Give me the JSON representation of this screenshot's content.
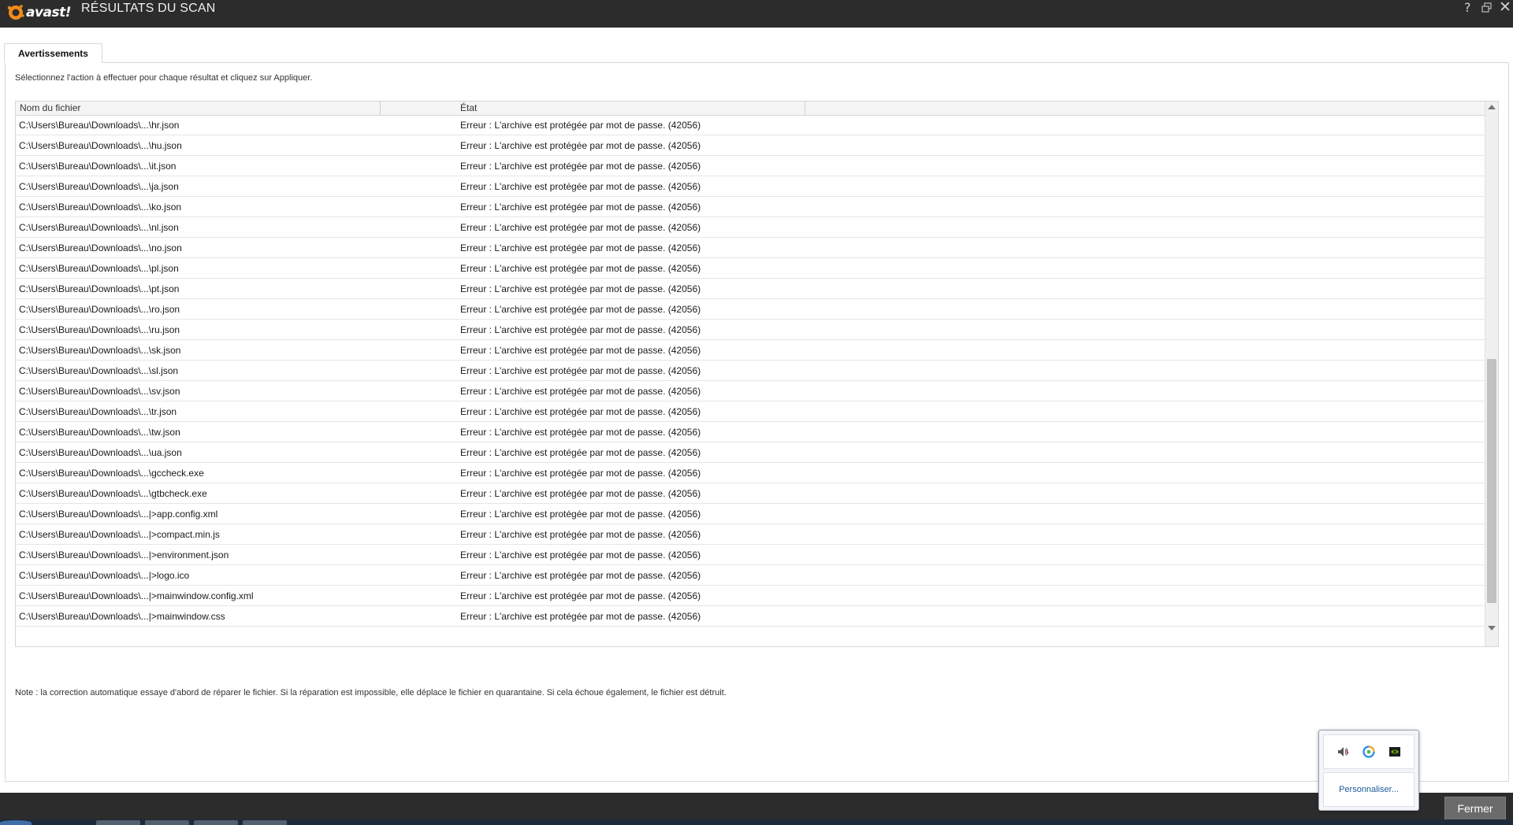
{
  "app": {
    "logo_text": "avast!",
    "title": "RÉSULTATS DU SCAN",
    "help_icon": "?",
    "restore_icon": "restore-icon",
    "close_icon": "✕"
  },
  "tabs": [
    {
      "label": "Avertissements"
    }
  ],
  "instruction": "Sélectionnez l'action à effectuer pour chaque résultat et cliquez sur Appliquer.",
  "table": {
    "columns": [
      "Nom du fichier",
      "État"
    ],
    "rows": [
      {
        "file": "C:\\Users\\Bureau\\Downloads\\...\\hr.json",
        "state": "Erreur : L'archive est protégée par mot de passe. (42056)"
      },
      {
        "file": "C:\\Users\\Bureau\\Downloads\\...\\hu.json",
        "state": "Erreur : L'archive est protégée par mot de passe. (42056)"
      },
      {
        "file": "C:\\Users\\Bureau\\Downloads\\...\\it.json",
        "state": "Erreur : L'archive est protégée par mot de passe. (42056)"
      },
      {
        "file": "C:\\Users\\Bureau\\Downloads\\...\\ja.json",
        "state": "Erreur : L'archive est protégée par mot de passe. (42056)"
      },
      {
        "file": "C:\\Users\\Bureau\\Downloads\\...\\ko.json",
        "state": "Erreur : L'archive est protégée par mot de passe. (42056)"
      },
      {
        "file": "C:\\Users\\Bureau\\Downloads\\...\\nl.json",
        "state": "Erreur : L'archive est protégée par mot de passe. (42056)"
      },
      {
        "file": "C:\\Users\\Bureau\\Downloads\\...\\no.json",
        "state": "Erreur : L'archive est protégée par mot de passe. (42056)"
      },
      {
        "file": "C:\\Users\\Bureau\\Downloads\\...\\pl.json",
        "state": "Erreur : L'archive est protégée par mot de passe. (42056)"
      },
      {
        "file": "C:\\Users\\Bureau\\Downloads\\...\\pt.json",
        "state": "Erreur : L'archive est protégée par mot de passe. (42056)"
      },
      {
        "file": "C:\\Users\\Bureau\\Downloads\\...\\ro.json",
        "state": "Erreur : L'archive est protégée par mot de passe. (42056)"
      },
      {
        "file": "C:\\Users\\Bureau\\Downloads\\...\\ru.json",
        "state": "Erreur : L'archive est protégée par mot de passe. (42056)"
      },
      {
        "file": "C:\\Users\\Bureau\\Downloads\\...\\sk.json",
        "state": "Erreur : L'archive est protégée par mot de passe. (42056)"
      },
      {
        "file": "C:\\Users\\Bureau\\Downloads\\...\\sl.json",
        "state": "Erreur : L'archive est protégée par mot de passe. (42056)"
      },
      {
        "file": "C:\\Users\\Bureau\\Downloads\\...\\sv.json",
        "state": "Erreur : L'archive est protégée par mot de passe. (42056)"
      },
      {
        "file": "C:\\Users\\Bureau\\Downloads\\...\\tr.json",
        "state": "Erreur : L'archive est protégée par mot de passe. (42056)"
      },
      {
        "file": "C:\\Users\\Bureau\\Downloads\\...\\tw.json",
        "state": "Erreur : L'archive est protégée par mot de passe. (42056)"
      },
      {
        "file": "C:\\Users\\Bureau\\Downloads\\...\\ua.json",
        "state": "Erreur : L'archive est protégée par mot de passe. (42056)"
      },
      {
        "file": "C:\\Users\\Bureau\\Downloads\\...\\gccheck.exe",
        "state": "Erreur : L'archive est protégée par mot de passe. (42056)"
      },
      {
        "file": "C:\\Users\\Bureau\\Downloads\\...\\gtbcheck.exe",
        "state": "Erreur : L'archive est protégée par mot de passe. (42056)"
      },
      {
        "file": "C:\\Users\\Bureau\\Downloads\\...|>app.config.xml",
        "state": "Erreur : L'archive est protégée par mot de passe. (42056)"
      },
      {
        "file": "C:\\Users\\Bureau\\Downloads\\...|>compact.min.js",
        "state": "Erreur : L'archive est protégée par mot de passe. (42056)"
      },
      {
        "file": "C:\\Users\\Bureau\\Downloads\\...|>environment.json",
        "state": "Erreur : L'archive est protégée par mot de passe. (42056)"
      },
      {
        "file": "C:\\Users\\Bureau\\Downloads\\...|>logo.ico",
        "state": "Erreur : L'archive est protégée par mot de passe. (42056)"
      },
      {
        "file": "C:\\Users\\Bureau\\Downloads\\...|>mainwindow.config.xml",
        "state": "Erreur : L'archive est protégée par mot de passe. (42056)"
      },
      {
        "file": "C:\\Users\\Bureau\\Downloads\\...|>mainwindow.css",
        "state": "Erreur : L'archive est protégée par mot de passe. (42056)"
      }
    ]
  },
  "note": "Note : la correction automatique essaye d'abord de réparer le fichier. Si la réparation est impossible, elle déplace le fichier en quarantaine. Si cela échoue également, le fichier est détruit.",
  "buttons": {
    "close_label": "Fermer"
  },
  "tray": {
    "icons": [
      "speaker-icon",
      "sync-icon",
      "nvidia-icon"
    ],
    "customize_label": "Personnaliser..."
  },
  "colors": {
    "titlebar_bg": "#2c2c2c",
    "logo_orange": "#f08b1c",
    "link_blue": "#1a5b9a"
  }
}
